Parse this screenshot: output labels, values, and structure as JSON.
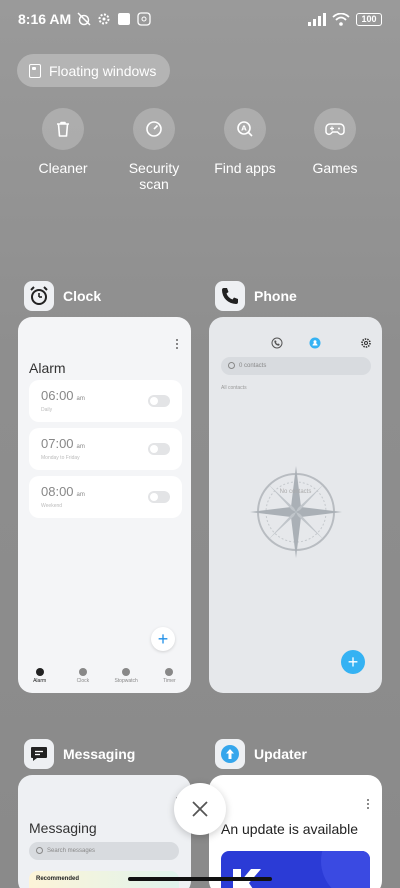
{
  "status_bar": {
    "time": "8:16 AM",
    "battery": "100"
  },
  "floating_windows": {
    "label": "Floating windows"
  },
  "quick_actions": [
    {
      "label": "Cleaner",
      "icon": "trash-icon"
    },
    {
      "label": "Security\nscan",
      "icon": "speedometer-icon"
    },
    {
      "label": "Find apps",
      "icon": "search-app-icon"
    },
    {
      "label": "Games",
      "icon": "gamepad-icon"
    }
  ],
  "apps": {
    "clock": {
      "name": "Clock",
      "screen_title": "Alarm",
      "alarms": [
        {
          "time": "06:00",
          "ampm": "am",
          "sub": "Daily"
        },
        {
          "time": "07:00",
          "ampm": "am",
          "sub": "Monday to Friday"
        },
        {
          "time": "08:00",
          "ampm": "am",
          "sub": "Weekend"
        }
      ],
      "tabs": [
        "Alarm",
        "Clock",
        "Stopwatch",
        "Timer"
      ]
    },
    "phone": {
      "name": "Phone",
      "search_placeholder": "0 contacts",
      "filter": "All contacts",
      "empty": "No contacts"
    },
    "messaging": {
      "name": "Messaging",
      "screen_title": "Messaging",
      "search_placeholder": "Search messages",
      "recommended": "Recommended"
    },
    "updater": {
      "name": "Updater",
      "message": "An update is available"
    }
  },
  "colors": {
    "accent": "#35b2f3",
    "fab_blue": "#1f8fe8",
    "updater_banner": "#2b3bd6"
  }
}
